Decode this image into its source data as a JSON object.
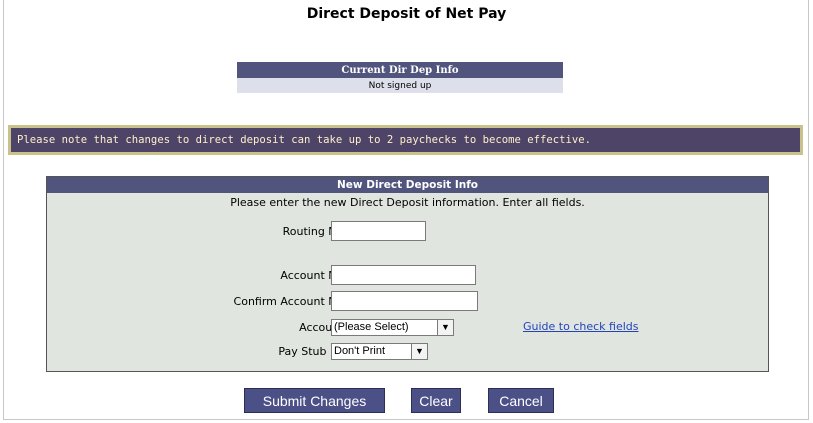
{
  "page": {
    "title": "Direct Deposit of Net Pay"
  },
  "current_info": {
    "header": "Current Dir Dep Info",
    "value": "Not signed up"
  },
  "notice": "Please note that changes to direct deposit can take up to 2 paychecks to become effective.",
  "form": {
    "header": "New Direct Deposit Info",
    "instructions": "Please enter the new Direct Deposit information. Enter all fields.",
    "routing_label": "Routing Number:",
    "routing_value": "",
    "account_label": "Account Number:",
    "account_value": "",
    "confirm_label": "Confirm Account Number:",
    "confirm_value": "",
    "account_type_label": "Account Type:",
    "account_type_selected": "(Please Select)",
    "guide_link": "Guide to check fields",
    "paystub_label": "Pay Stub Printing:",
    "paystub_selected": "Don't Print"
  },
  "buttons": {
    "submit": "Submit Changes",
    "clear": "Clear",
    "cancel": "Cancel"
  },
  "colors": {
    "header_bg": "#51557e",
    "form_bg": "#e1e5df",
    "notice_bg": "#4e4468",
    "notice_border": "#c9c28a",
    "link": "#2244bb"
  }
}
